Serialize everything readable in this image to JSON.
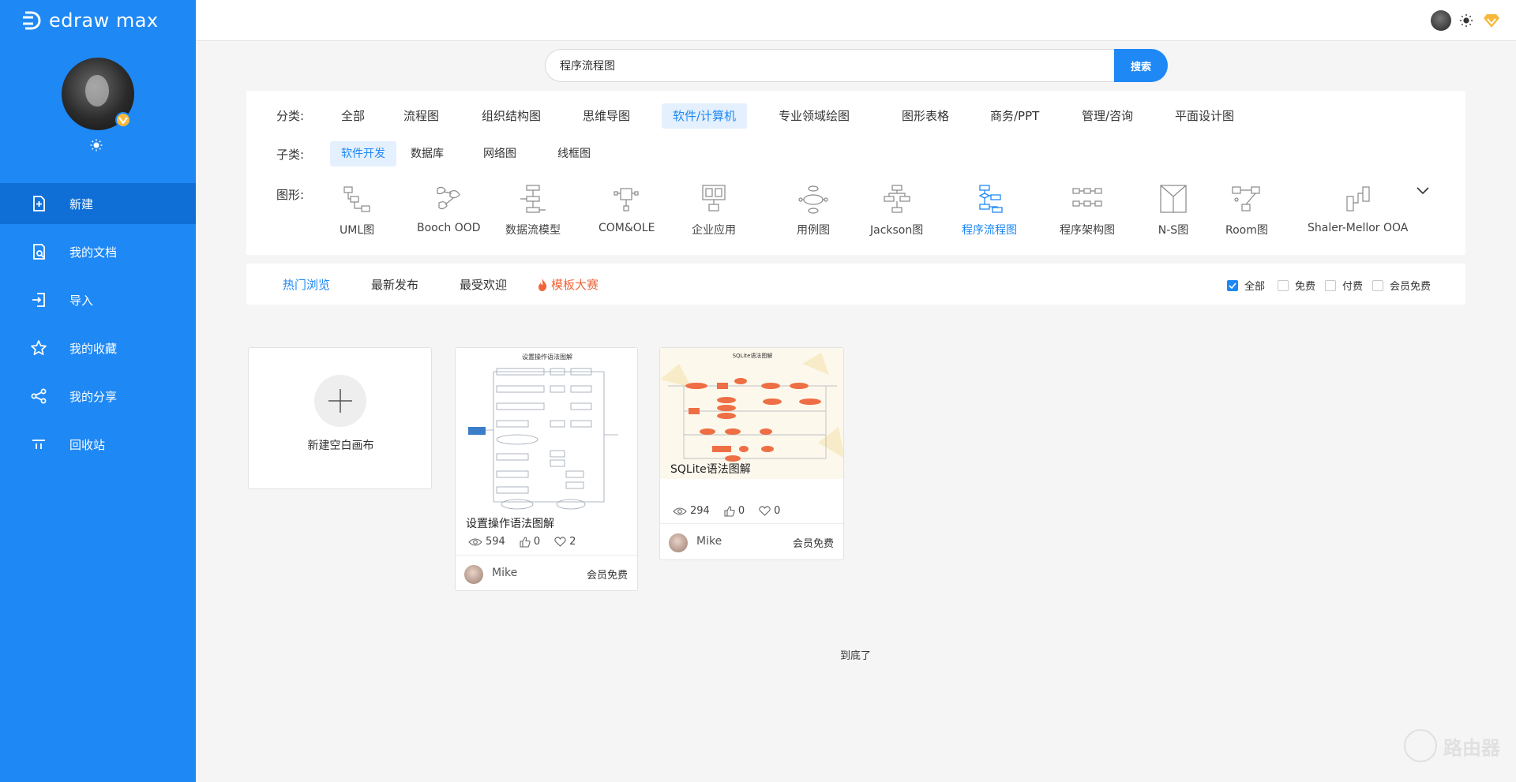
{
  "app": {
    "logo_text": "edraw max"
  },
  "sidebar": {
    "items": [
      {
        "label": "新建",
        "icon": "new-file-icon",
        "active": true
      },
      {
        "label": "我的文档",
        "icon": "documents-icon"
      },
      {
        "label": "导入",
        "icon": "import-icon"
      },
      {
        "label": "我的收藏",
        "icon": "star-icon"
      },
      {
        "label": "我的分享",
        "icon": "share-icon"
      },
      {
        "label": "回收站",
        "icon": "recycle-bin-icon"
      }
    ]
  },
  "search": {
    "value": "程序流程图",
    "button_label": "搜索"
  },
  "filter": {
    "category_label": "分类:",
    "categories": [
      "全部",
      "流程图",
      "组织结构图",
      "思维导图",
      "软件/计算机",
      "专业领域绘图",
      "图形表格",
      "商务/PPT",
      "管理/咨询",
      "平面设计图"
    ],
    "category_active": "软件/计算机",
    "subcategory_label": "子类:",
    "subcategories": [
      "软件开发",
      "数据库",
      "网络图",
      "线框图"
    ],
    "subcategory_active": "软件开发",
    "shape_label": "图形:",
    "shapes": [
      "UML图",
      "Booch OOD",
      "数据流模型",
      "COM&OLE",
      "企业应用",
      "用例图",
      "Jackson图",
      "程序流程图",
      "程序架构图",
      "N-S图",
      "Room图",
      "Shaler-Mellor OOA"
    ],
    "shape_active": "程序流程图"
  },
  "tabs": {
    "items": [
      "热门浏览",
      "最新发布",
      "最受欢迎",
      "模板大赛"
    ],
    "active": "热门浏览",
    "checkboxes": [
      {
        "label": "全部",
        "checked": true
      },
      {
        "label": "免费",
        "checked": false
      },
      {
        "label": "付费",
        "checked": false
      },
      {
        "label": "会员免费",
        "checked": false
      }
    ]
  },
  "blank_card": {
    "label": "新建空白画布"
  },
  "templates": [
    {
      "title": "设置操作语法图解",
      "thumb_title": "设置操作语法图解",
      "views": "594",
      "likes": "0",
      "favorites": "2",
      "author": "Mike",
      "price": "会员免费"
    },
    {
      "title": "SQLite语法图解",
      "thumb_title": "SQLite语法图解",
      "views": "294",
      "likes": "0",
      "favorites": "0",
      "author": "Mike",
      "price": "会员免费"
    }
  ],
  "footer_text": "到底了",
  "watermark_text": "路由器",
  "colors": {
    "primary": "#1e88f5",
    "active_nav": "#0f6fd6",
    "contest": "#f0663a",
    "vip": "#f6b93b"
  }
}
